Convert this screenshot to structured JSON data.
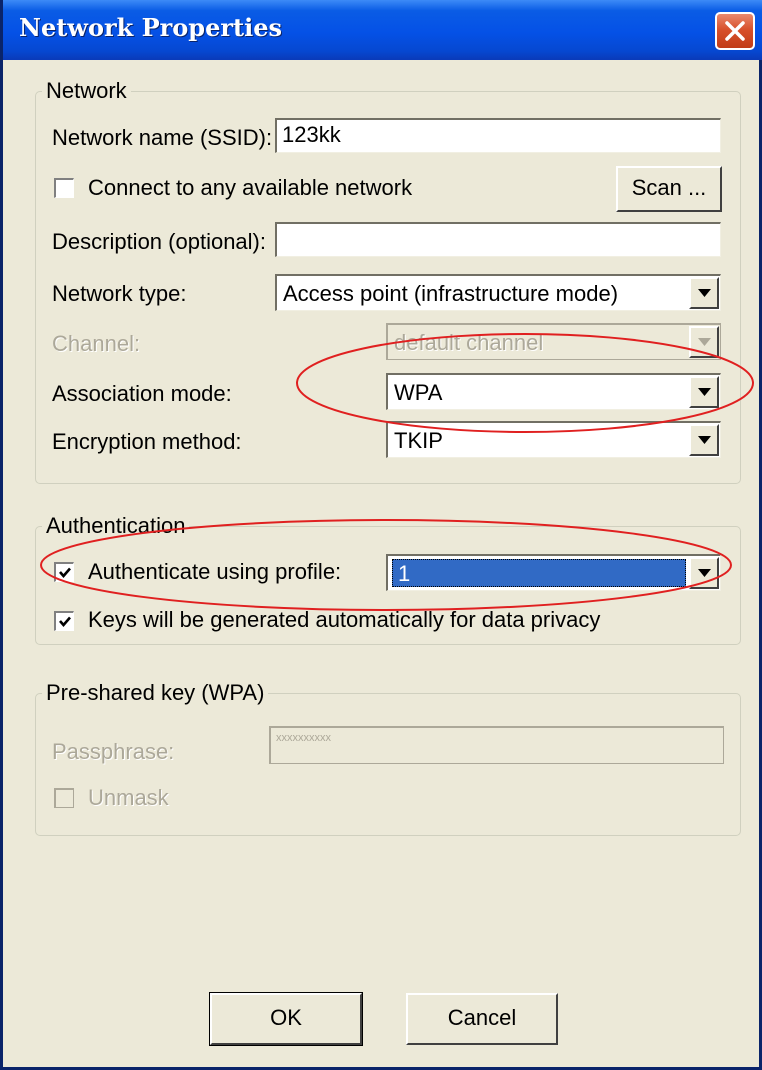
{
  "window": {
    "title": "Network Properties"
  },
  "network_group": {
    "legend": "Network",
    "ssid_label": "Network name (SSID):",
    "ssid_value": "123kk",
    "connect_any_label": "Connect to any available network",
    "connect_any_checked": false,
    "scan_button": "Scan ...",
    "description_label": "Description (optional):",
    "description_value": "",
    "network_type_label": "Network type:",
    "network_type_value": "Access point (infrastructure mode)",
    "channel_label": "Channel:",
    "channel_value": "default channel",
    "association_label": "Association mode:",
    "association_value": "WPA",
    "encryption_label": "Encryption method:",
    "encryption_value": "TKIP"
  },
  "authentication_group": {
    "legend": "Authentication",
    "auth_profile_label": "Authenticate using profile:",
    "auth_profile_checked": true,
    "auth_profile_value": "1",
    "auto_keys_label": "Keys will be generated automatically for data privacy",
    "auto_keys_checked": true
  },
  "psk_group": {
    "legend": "Pre-shared key (WPA)",
    "passphrase_label": "Passphrase:",
    "passphrase_value": "xxxxxxxxxx",
    "unmask_label": "Unmask",
    "unmask_checked": false
  },
  "footer": {
    "ok_button": "OK",
    "cancel_button": "Cancel"
  },
  "colors": {
    "titlebar_blue": "#0551e6",
    "dialog_face": "#ece9d8",
    "annotation_red": "#e02020",
    "selection_blue": "#316ac5"
  },
  "icons": [
    "close-icon",
    "dropdown-arrow-icon",
    "checkmark-icon"
  ]
}
